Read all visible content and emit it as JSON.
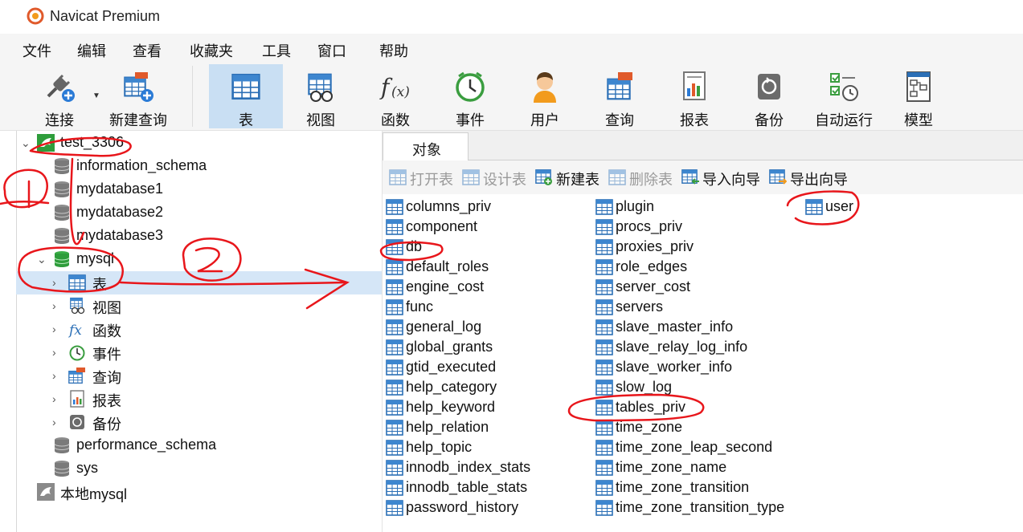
{
  "window": {
    "title": "Navicat Premium"
  },
  "menu": [
    "文件",
    "编辑",
    "查看",
    "收藏夹",
    "工具",
    "窗口",
    "帮助"
  ],
  "toolbar": {
    "buttons": [
      {
        "label": "连接",
        "icon": "connection-plug-icon"
      },
      {
        "label": "新建查询",
        "icon": "new-query-icon"
      },
      {
        "label": "表",
        "icon": "table-icon",
        "active": true
      },
      {
        "label": "视图",
        "icon": "view-icon"
      },
      {
        "label": "函数",
        "icon": "function-icon"
      },
      {
        "label": "事件",
        "icon": "event-clock-icon"
      },
      {
        "label": "用户",
        "icon": "user-icon"
      },
      {
        "label": "查询",
        "icon": "query-icon"
      },
      {
        "label": "报表",
        "icon": "report-icon"
      },
      {
        "label": "备份",
        "icon": "backup-icon"
      },
      {
        "label": "自动运行",
        "icon": "automation-icon"
      },
      {
        "label": "模型",
        "icon": "model-icon"
      }
    ]
  },
  "navigator": {
    "connection": "test_3306",
    "databases_before": [
      "information_schema",
      "mydatabase1",
      "mydatabase2",
      "mydatabase3"
    ],
    "open_database": "mysql",
    "children": [
      "表",
      "视图",
      "函数",
      "事件",
      "查询",
      "报表",
      "备份"
    ],
    "databases_after": [
      "performance_schema",
      "sys"
    ],
    "other_connection": "本地mysql"
  },
  "objects": {
    "tab": "对象",
    "tools": [
      "打开表",
      "设计表",
      "新建表",
      "删除表",
      "导入向导",
      "导出向导"
    ],
    "col1": [
      "columns_priv",
      "component",
      "db",
      "default_roles",
      "engine_cost",
      "func",
      "general_log",
      "global_grants",
      "gtid_executed",
      "help_category",
      "help_keyword",
      "help_relation",
      "help_topic",
      "innodb_index_stats",
      "innodb_table_stats",
      "password_history"
    ],
    "col2": [
      "plugin",
      "procs_priv",
      "proxies_priv",
      "role_edges",
      "server_cost",
      "servers",
      "slave_master_info",
      "slave_relay_log_info",
      "slave_worker_info",
      "slow_log",
      "tables_priv",
      "time_zone",
      "time_zone_leap_second",
      "time_zone_name",
      "time_zone_transition",
      "time_zone_transition_type"
    ],
    "col3": [
      "user"
    ]
  },
  "colors": {
    "accent": "#c9dff3",
    "selected_row": "#d5e6f7",
    "annotation": "#e8161b",
    "db_green": "#2e9d3b"
  }
}
